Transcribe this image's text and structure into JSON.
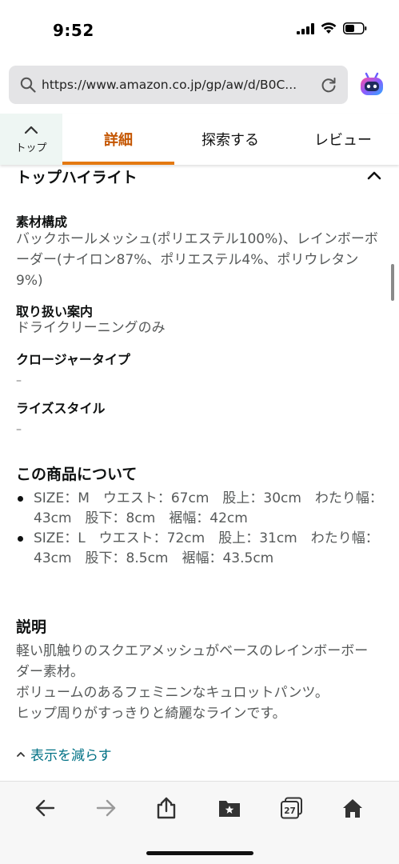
{
  "status_bar": {
    "time": "9:52"
  },
  "browser": {
    "url": "https://www.amazon.co.jp/gp/aw/d/B0C..."
  },
  "tabs": {
    "top_label": "トップ",
    "items": [
      {
        "label": "詳細",
        "active": true
      },
      {
        "label": "探索する",
        "active": false
      },
      {
        "label": "レビュー",
        "active": false
      }
    ]
  },
  "highlights": {
    "title": "トップハイライト",
    "attributes": [
      {
        "label": "素材構成",
        "value": "バックホールメッシュ(ポリエステル100%)、レインボーボーダー(ナイロン87%、ポリエステル4%、ポリウレタン9%)"
      },
      {
        "label": "取り扱い案内",
        "value": "ドライクリーニングのみ"
      },
      {
        "label": "クロージャータイプ",
        "value": "–"
      },
      {
        "label": "ライズスタイル",
        "value": "–"
      }
    ]
  },
  "about": {
    "title": "この商品について",
    "bullets": [
      "SIZE：M　ウエスト：67cm　股上：30cm　わたり幅：43cm　股下：8cm　裾幅：42cm",
      "SIZE：L　ウエスト：72cm　股上：31cm　わたり幅：43cm　股下：8.5cm　裾幅：43.5cm"
    ]
  },
  "description": {
    "title": "説明",
    "lines": [
      "軽い肌触りのスクエアメッシュがベースのレインボーボーダー素材。",
      "ボリュームのあるフェミニンなキュロットパンツ。",
      "ヒップ周りがすっきりと綺麗なラインです。"
    ],
    "show_less": "表示を減らす"
  },
  "toolbar": {
    "tabs_count": "27"
  },
  "colors": {
    "accent_tab": "#c45500",
    "tab_underline": "#e47911",
    "link": "#007185",
    "text_secondary": "#565959"
  },
  "icons": [
    "search-icon",
    "reload-icon",
    "assistant-bot-icon",
    "chevron-up-icon",
    "back-arrow-icon",
    "forward-arrow-icon",
    "share-icon",
    "bookmarks-icon",
    "tabs-icon",
    "home-icon"
  ]
}
